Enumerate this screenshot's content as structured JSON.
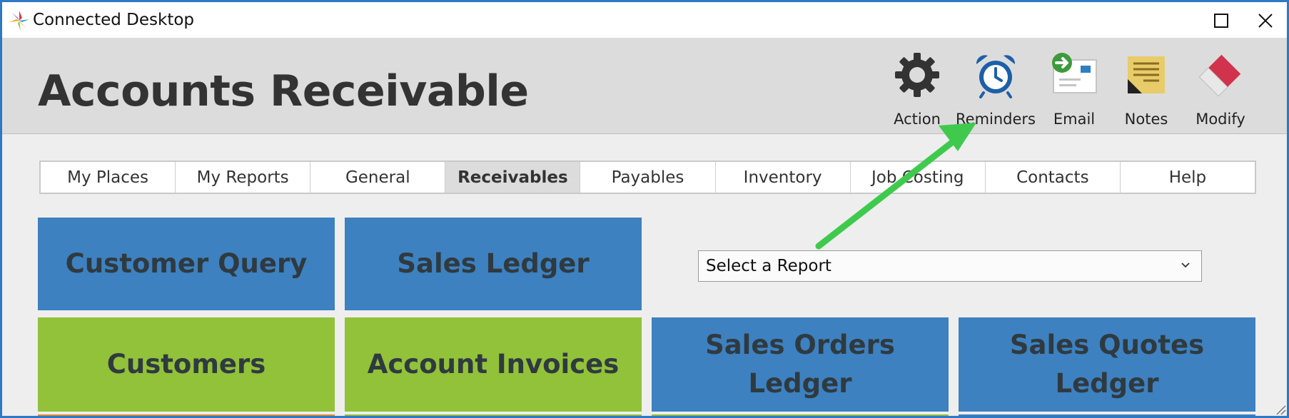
{
  "window": {
    "title": "Connected Desktop"
  },
  "header": {
    "title": "Accounts Receivable",
    "tools": [
      {
        "label": "Action",
        "icon": "gear-icon"
      },
      {
        "label": "Reminders",
        "icon": "alarm-clock-icon"
      },
      {
        "label": "Email",
        "icon": "email-icon"
      },
      {
        "label": "Notes",
        "icon": "notes-icon"
      },
      {
        "label": "Modify",
        "icon": "eraser-icon"
      }
    ]
  },
  "tabs": [
    {
      "label": "My Places",
      "active": false
    },
    {
      "label": "My Reports",
      "active": false
    },
    {
      "label": "General",
      "active": false
    },
    {
      "label": "Receivables",
      "active": true
    },
    {
      "label": "Payables",
      "active": false
    },
    {
      "label": "Inventory",
      "active": false
    },
    {
      "label": "Job Costing",
      "active": false
    },
    {
      "label": "Contacts",
      "active": false
    },
    {
      "label": "Help",
      "active": false
    }
  ],
  "tiles": {
    "customer_query": "Customer Query",
    "sales_ledger": "Sales Ledger",
    "customers": "Customers",
    "account_invoices": "Account Invoices",
    "sales_orders_ledger_1": "Sales Orders",
    "sales_orders_ledger_2": "Ledger",
    "sales_quotes_ledger_1": "Sales Quotes",
    "sales_quotes_ledger_2": "Ledger"
  },
  "report_select": {
    "value": "Select a Report"
  },
  "colors": {
    "tile_blue": "#3d81c0",
    "tile_green": "#92c13a",
    "window_border": "#2f78c4",
    "annotation_arrow": "#3fca4d"
  }
}
